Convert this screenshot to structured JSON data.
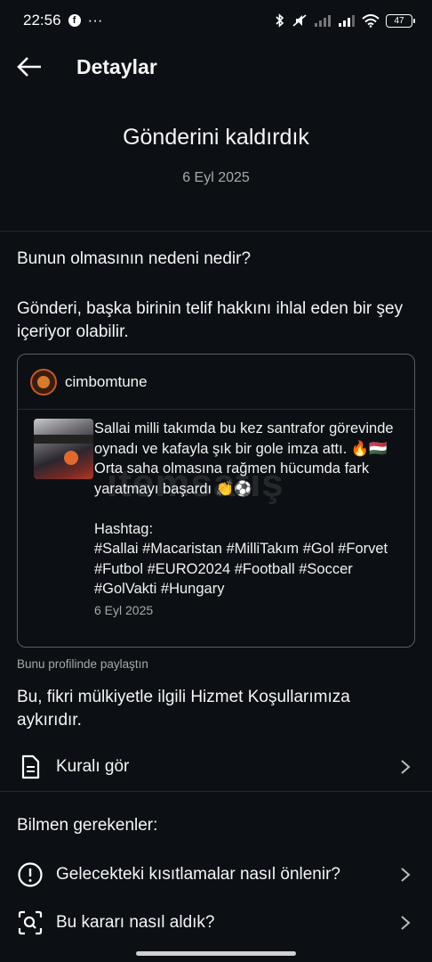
{
  "status_bar": {
    "time": "22:56",
    "fb_letter": "f",
    "more": "···",
    "battery": "47"
  },
  "header": {
    "title": "Detaylar"
  },
  "notice": {
    "headline": "Gönderini kaldırdık",
    "date": "6 Eyl 2025"
  },
  "reason_section": {
    "question": "Bunun olmasının nedeni nedir?",
    "reason": "Gönderi, başka birinin telif hakkını ihlal eden bir şey içeriyor olabilir."
  },
  "post": {
    "username": "cimbomtune",
    "caption": "Sallai milli takımda bu kez santrafor görevinde oynadı ve kafayla şık bir gole imza attı. 🔥🇭🇺\nOrta saha olmasına rağmen hücumda fark yaratmayı başardı 👏⚽\n\nHashtag:\n#Sallai #Macaristan #MilliTakım #Gol #Forvet #Futbol #EURO2024 #Football #Soccer #GolVakti #Hungary",
    "date": "6 Eyl 2025",
    "watermark": "itemsatış"
  },
  "shared_note": "Bunu profilinde paylaştın",
  "policy_text": "Bu, fikri mülkiyetle ilgili Hizmet Koşullarımıza aykırıdır.",
  "rule_row": {
    "label": "Kuralı gör",
    "icon": "document-icon"
  },
  "know_section": {
    "title": "Bilmen gerekenler:",
    "items": [
      {
        "label": "Gelecekteki kısıtlamalar nasıl önlenir?",
        "icon": "exclamation-circle-icon"
      },
      {
        "label": "Bu kararı nasıl aldık?",
        "icon": "search-scan-icon"
      }
    ]
  }
}
